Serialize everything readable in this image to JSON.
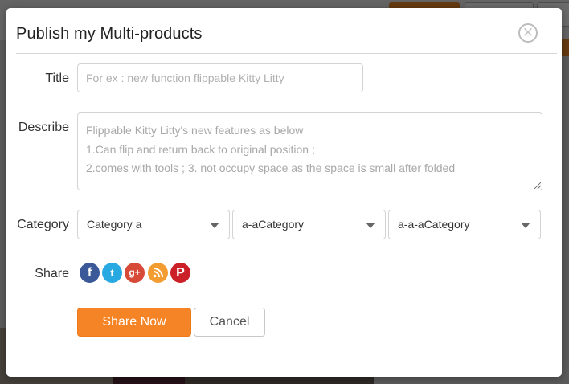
{
  "modal": {
    "title": "Publish my Multi-products",
    "close_icon": "close-circle-icon",
    "close_glyph": "×"
  },
  "form": {
    "title_label": "Title",
    "title_placeholder": "For ex : new function flippable Kitty Litty",
    "title_value": "",
    "describe_label": "Describe",
    "describe_lines": [
      "Flippable Kitty Litty's new features as below",
      "1.Can flip and return back to original position ;",
      "2.comes with tools ; 3. not occupy space as the space is small after folded"
    ],
    "category_label": "Category",
    "categories": [
      {
        "selected": "Category a"
      },
      {
        "selected": "a-aCategory"
      },
      {
        "selected": "a-a-aCategory"
      }
    ],
    "share_label": "Share",
    "share_icons": [
      {
        "name": "facebook-icon",
        "glyph": "f",
        "color": "#3b5998"
      },
      {
        "name": "twitter-icon",
        "glyph": "t",
        "color": "#29a9e1"
      },
      {
        "name": "google-plus-icon",
        "glyph": "g+",
        "color": "#d84a38"
      },
      {
        "name": "rss-icon",
        "glyph": "",
        "color": "#f39c31"
      },
      {
        "name": "pinterest-icon",
        "glyph": "P",
        "color": "#cb2027"
      }
    ]
  },
  "actions": {
    "primary_label": "Share Now",
    "cancel_label": "Cancel"
  },
  "colors": {
    "accent": "#f58426",
    "overlay": "rgba(0,0,0,0.58)"
  }
}
